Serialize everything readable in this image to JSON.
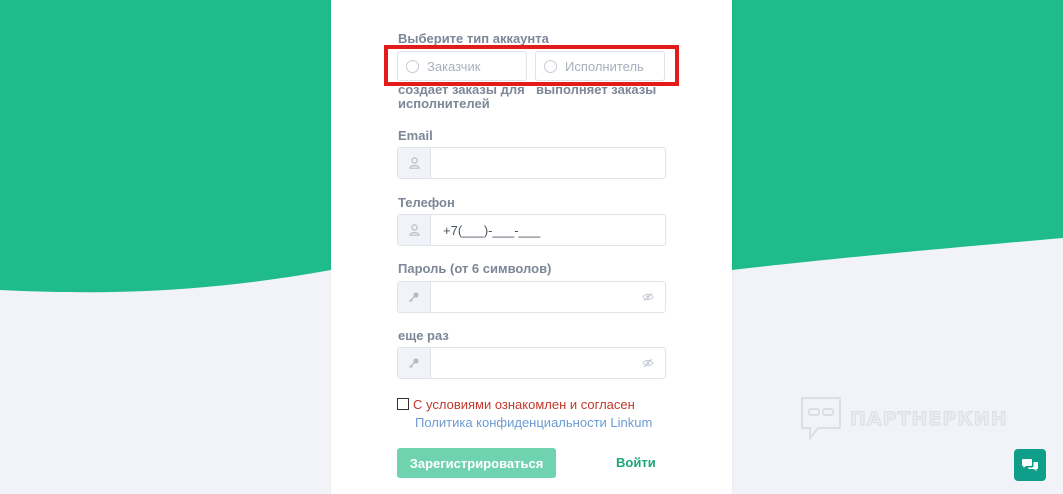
{
  "form": {
    "account_type_label": "Выберите тип аккаунта",
    "account_types": [
      {
        "label": "Заказчик",
        "description": "создает заказы для исполнителей"
      },
      {
        "label": "Исполнитель",
        "description": "выполняет заказы"
      }
    ],
    "email_label": "Email",
    "email_value": "",
    "phone_label": "Телефон",
    "phone_value": "+7(___)-___-___",
    "password_label": "Пароль (от 6 символов)",
    "password_value": "",
    "repeat_label": "еще раз",
    "repeat_value": "",
    "agree_text": "С условиями ознакомлен и согласен",
    "policy_link": "Политика конфиденциальности Linkum",
    "register_button": "Зарегистрироваться",
    "login_link": "Войти"
  },
  "watermark": {
    "text": "ПАРТНЕРКИН"
  },
  "colors": {
    "brand_green": "#1fbb8a",
    "highlight": "#e31b1b",
    "register_button": "#6fd3b0",
    "agree_text": "#c0392b",
    "link": "#6b9bd2",
    "chat_button": "#0f9e8a"
  },
  "icons": {
    "email_field": "user-icon",
    "phone_field": "user-icon",
    "password_field": "key-icon",
    "password_toggle": "eye-slash-icon",
    "chat": "chat-bubbles-icon"
  }
}
